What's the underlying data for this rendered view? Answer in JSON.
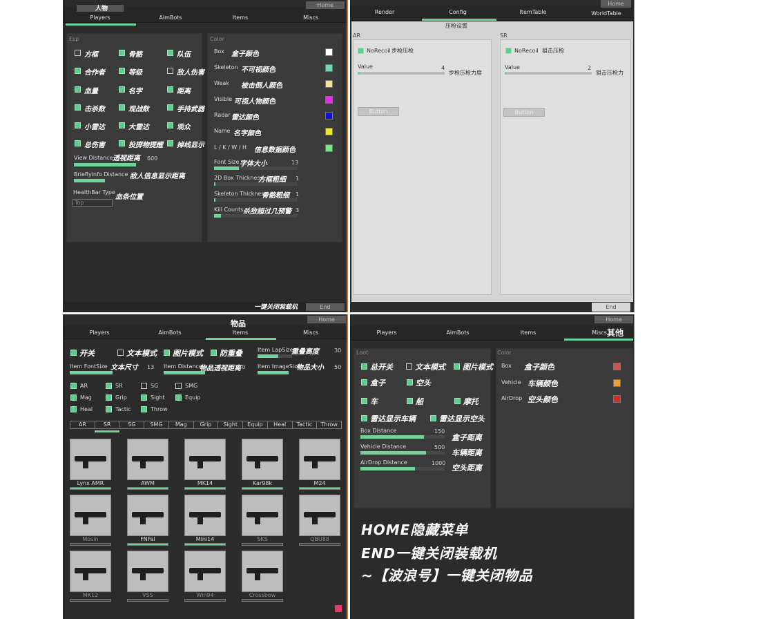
{
  "tl": {
    "title": "人物",
    "home": "Home",
    "end": "End",
    "end_note": "一键关闭装载机",
    "tabs": [
      "Players",
      "AimBots",
      "Items",
      "Miscs"
    ],
    "esp_label": "Esp",
    "color_label": "Color",
    "checks": [
      {
        "t": "方框",
        "on": false
      },
      {
        "t": "骨骼",
        "on": true
      },
      {
        "t": "队伍",
        "on": true
      },
      {
        "t": "合作者",
        "on": true
      },
      {
        "t": "等级",
        "on": true
      },
      {
        "t": "敌人伤害",
        "on": false
      },
      {
        "t": "血量",
        "on": true
      },
      {
        "t": "名字",
        "on": true
      },
      {
        "t": "距离",
        "on": true
      },
      {
        "t": "击杀数",
        "on": true
      },
      {
        "t": "观战数",
        "on": true
      },
      {
        "t": "手持武器",
        "on": true
      },
      {
        "t": "小雷达",
        "on": true
      },
      {
        "t": "大雷达",
        "on": true
      },
      {
        "t": "观众",
        "on": true
      },
      {
        "t": "总伤害",
        "on": true
      },
      {
        "t": "投掷物提醒",
        "on": true
      },
      {
        "t": "掉线显示",
        "on": true
      }
    ],
    "view_distance": {
      "en": "View Distance",
      "cn": "透视距离",
      "val": "600",
      "pct": 0.55
    },
    "brief": {
      "en": "BrieflyInfo Distance",
      "cn": "敌人信息显示距离",
      "pct": 0.5
    },
    "healthbar": {
      "en": "HealthBar Type",
      "cn": "血条位置",
      "value": "Top"
    },
    "colors": [
      {
        "en": "Box",
        "cn": "盒子颜色",
        "c": "#ffffff"
      },
      {
        "en": "Skeleton",
        "cn": "不可视颜色",
        "c": "#6fd8b0"
      },
      {
        "en": "Weak",
        "cn": "被击倒人颜色",
        "c": "#f3e39b"
      },
      {
        "en": "Visible",
        "cn": "可视人物颜色",
        "c": "#e030e8"
      },
      {
        "en": "Radar",
        "cn": "雷达颜色",
        "c": "#1010d0"
      },
      {
        "en": "Name",
        "cn": "名字颜色",
        "c": "#f0e838"
      },
      {
        "en": "L / K / W / H",
        "cn": "信息数据颜色",
        "c": "#7fe08a"
      }
    ],
    "csliders": [
      {
        "en": "Font Size",
        "cn": "字体大小",
        "val": "13",
        "pct": 0.3
      },
      {
        "en": "2D Box Thickness",
        "cn": "方框粗细",
        "val": "1",
        "pct": 0.02
      },
      {
        "en": "Skeleton Thickness",
        "cn": "骨骼粗细",
        "val": "1",
        "pct": 0.02
      },
      {
        "en": "Kill Counts",
        "cn": "杀敌超过几预警",
        "val": "3",
        "pct": 0.08
      }
    ]
  },
  "tr": {
    "home": "Home",
    "end": "End",
    "tabs": [
      "Render",
      "Config",
      "ItemTable",
      "WorldTable"
    ],
    "subtitle": "压枪设置",
    "ar": {
      "label": "AR",
      "norecoil": "NoRecoil",
      "cn": "步枪压枪",
      "value_label": "Value",
      "val": "4",
      "cn2": "步枪压枪力度",
      "button": "Button"
    },
    "sr": {
      "label": "SR",
      "norecoil": "NoRecoil",
      "cn": "狙击压枪",
      "value_label": "Value",
      "val": "2",
      "cn2": "狙击压枪力",
      "button": "Button"
    }
  },
  "bl": {
    "title": "物品",
    "home": "Home",
    "tabs": [
      "Players",
      "AimBots",
      "Items",
      "Miscs"
    ],
    "top": [
      {
        "t": "开关",
        "on": true
      },
      {
        "t": "文本模式",
        "on": false
      },
      {
        "t": "图片模式",
        "on": true
      },
      {
        "t": "防重叠",
        "on": true
      }
    ],
    "lapsize": {
      "en": "Item LapSize",
      "cn": "重叠高度",
      "val": "30"
    },
    "fontsize": {
      "en": "Item FontSize",
      "cn": "文本尺寸",
      "val": "13"
    },
    "distance": {
      "en": "Item Distance",
      "cn": "物品透视距离",
      "val": "30"
    },
    "imagesize": {
      "en": "Item ImageSize",
      "cn": "物品大小",
      "val": "50"
    },
    "cats": [
      {
        "t": "AR",
        "on": true
      },
      {
        "t": "SR",
        "on": true
      },
      {
        "t": "SG",
        "on": false
      },
      {
        "t": "SMG",
        "on": false
      },
      {
        "t": "Mag",
        "on": true
      },
      {
        "t": "Grip",
        "on": true
      },
      {
        "t": "Sight",
        "on": true
      },
      {
        "t": "Equip",
        "on": true
      },
      {
        "t": "Heal",
        "on": true
      },
      {
        "t": "Tactic",
        "on": true
      },
      {
        "t": "Throw",
        "on": true
      }
    ],
    "gridtabs": [
      "AR",
      "SR",
      "SG",
      "SMG",
      "Mag",
      "Grip",
      "Sight",
      "Equip",
      "Heal",
      "Tactic",
      "Throw"
    ],
    "items": [
      {
        "n": "Lynx AMR",
        "on": true
      },
      {
        "n": "AWM",
        "on": true
      },
      {
        "n": "MK14",
        "on": true
      },
      {
        "n": "Kar98k",
        "on": true
      },
      {
        "n": "M24",
        "on": true
      },
      {
        "n": "Mosin",
        "on": false
      },
      {
        "n": "FNFal",
        "on": true
      },
      {
        "n": "Mini14",
        "on": true
      },
      {
        "n": "SKS",
        "on": false
      },
      {
        "n": "QBU88",
        "on": false
      },
      {
        "n": "MK12",
        "on": false
      },
      {
        "n": "VSS",
        "on": false
      },
      {
        "n": "Win94",
        "on": false
      },
      {
        "n": "Crossbow",
        "on": false
      }
    ]
  },
  "br": {
    "title": "其他",
    "home": "Home",
    "tabs": [
      "Players",
      "AimBots",
      "Items",
      "Miscs"
    ],
    "loot_label": "Loot",
    "color_label": "Color",
    "r1": [
      {
        "t": "总开关",
        "on": true
      },
      {
        "t": "文本模式",
        "on": false
      },
      {
        "t": "图片模式",
        "on": true
      }
    ],
    "r2": [
      {
        "t": "盒子",
        "on": true
      },
      {
        "t": "空头",
        "on": true
      }
    ],
    "r3": [
      {
        "t": "车",
        "on": true
      },
      {
        "t": "船",
        "on": true
      },
      {
        "t": "摩托",
        "on": true
      }
    ],
    "r4": [
      {
        "t": "雷达显示车辆",
        "on": true
      },
      {
        "t": "雷达显示空头",
        "on": true
      }
    ],
    "sliders": [
      {
        "en": "Box Distance",
        "cn": "盒子距离",
        "val": "150",
        "pct": 0.75
      },
      {
        "en": "Vehicle Distance",
        "cn": "车辆距离",
        "val": "500",
        "pct": 0.78
      },
      {
        "en": "AirDrop Distance",
        "cn": "空头距离",
        "val": "1000",
        "pct": 0.65
      }
    ],
    "colors": [
      {
        "en": "Box",
        "cn": "盒子颜色",
        "c": "#d05050"
      },
      {
        "en": "Vehicle",
        "cn": "车辆颜色",
        "c": "#f0a030"
      },
      {
        "en": "AirDrop",
        "cn": "空头颜色",
        "c": "#e82020"
      }
    ],
    "overlay": [
      "HOME隐藏菜单",
      "END一键关闭装载机",
      "~【波浪号】一键关闭物品"
    ]
  }
}
